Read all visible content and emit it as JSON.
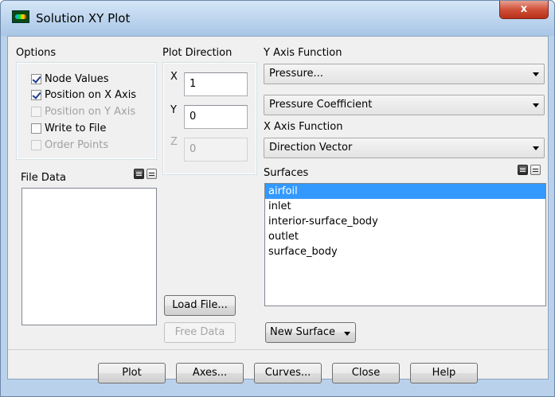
{
  "window": {
    "title": "Solution XY Plot",
    "close_label": "x"
  },
  "options": {
    "label": "Options",
    "items": [
      {
        "label": "Node Values",
        "checked": true,
        "enabled": true
      },
      {
        "label": "Position on X Axis",
        "checked": true,
        "enabled": true
      },
      {
        "label": "Position on Y Axis",
        "checked": false,
        "enabled": false
      },
      {
        "label": "Write to File",
        "checked": false,
        "enabled": true
      },
      {
        "label": "Order Points",
        "checked": false,
        "enabled": false
      }
    ]
  },
  "plot_direction": {
    "label": "Plot Direction",
    "x_label": "X",
    "x_value": "1",
    "y_label": "Y",
    "y_value": "0",
    "z_label": "Z",
    "z_value": "0"
  },
  "y_axis_function": {
    "label": "Y Axis Function",
    "category": "Pressure...",
    "value": "Pressure Coefficient"
  },
  "x_axis_function": {
    "label": "X Axis Function",
    "value": "Direction Vector"
  },
  "file_data": {
    "label": "File Data",
    "items": []
  },
  "surfaces": {
    "label": "Surfaces",
    "items": [
      "airfoil",
      "inlet",
      "interior-surface_body",
      "outlet",
      "surface_body"
    ],
    "selected": "airfoil"
  },
  "buttons": {
    "load_file": "Load File...",
    "free_data": "Free Data",
    "new_surface": "New Surface",
    "plot": "Plot",
    "axes": "Axes...",
    "curves": "Curves...",
    "close": "Close",
    "help": "Help"
  }
}
